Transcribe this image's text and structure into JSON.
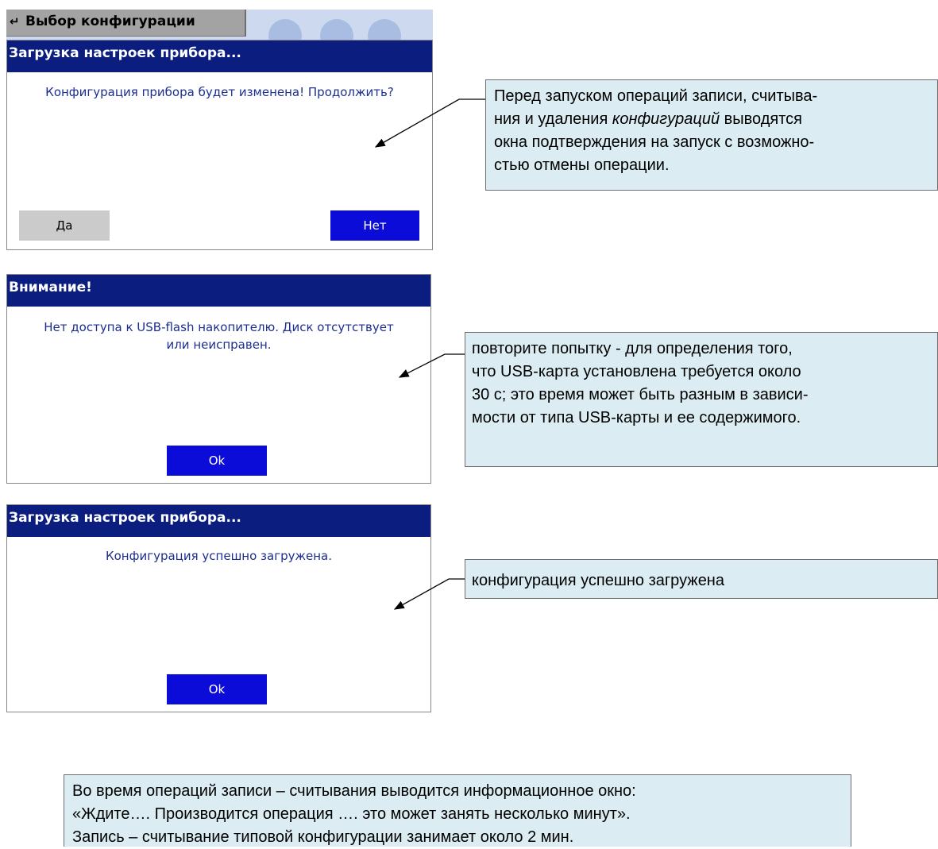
{
  "top_window": {
    "back_icon": "return-arrow-icon",
    "title": "Выбор конфигурации"
  },
  "dialog_confirm": {
    "title": "Загрузка настроек прибора...",
    "message": "Конфигурация прибора будет изменена! Продолжить?",
    "yes_label": "Да",
    "no_label": "Нет"
  },
  "dialog_warning": {
    "title": "Внимание!",
    "message_line1": "Нет доступа к USB-flash накопителю. Диск отсутствует",
    "message_line2": "или неисправен.",
    "ok_label": "Ok"
  },
  "dialog_success": {
    "title": "Загрузка настроек прибора...",
    "message": "Конфигурация успешно загружена.",
    "ok_label": "Ok"
  },
  "callout_1": {
    "line1": "Перед запуском операций записи, считыва-",
    "line2": "ния и удаления",
    "line2_italic": "конфигураций",
    "line2_end": "выводятся",
    "line3": "окна подтверждения на запуск с возможно-",
    "line4": "стью отмены операции."
  },
  "callout_2": {
    "line1": "повторите попытку - для определения того,",
    "line2": "что USB-карта установлена требуется около",
    "line3": "30 с; это время может быть разным в зависи-",
    "line4": "мости от типа USB-карты и ее содержимого."
  },
  "callout_3": {
    "line1": "конфигурация успешно загружена"
  },
  "bottom_note": {
    "line1": "Во время операций записи – считывания выводится информационное окно:",
    "line2": "«Ждите….  Производится операция ….   это может занять несколько минут».",
    "line3": "Запись – считывание типовой конфигурации занимает около 2 мин."
  },
  "colors": {
    "titlebar": "#0b1e80",
    "button_blue": "#0c0cd8",
    "button_grey": "#cbcbcb",
    "message_text": "#1c2f8f",
    "callout_bg": "#dbedf3"
  }
}
